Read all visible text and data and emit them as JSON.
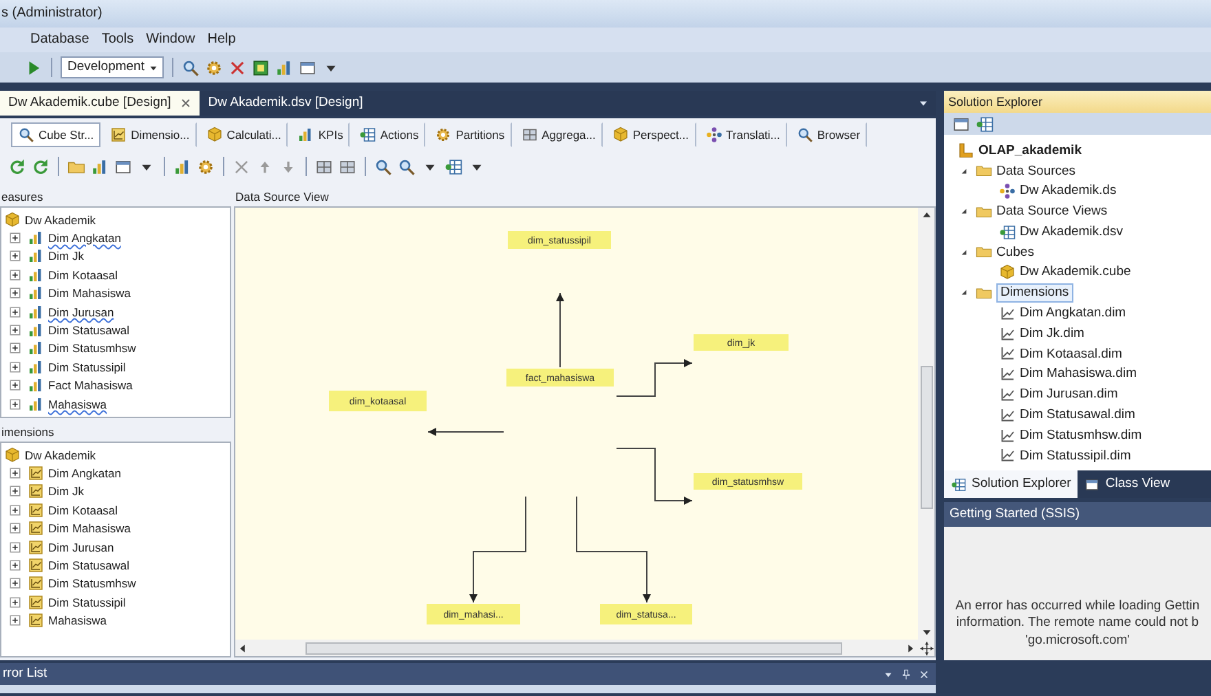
{
  "window": {
    "title": "s (Administrator)"
  },
  "menu": [
    {
      "label": "Database"
    },
    {
      "label": "Tools"
    },
    {
      "label": "Window"
    },
    {
      "label": "Help"
    }
  ],
  "toolbar": {
    "configuration": "Development"
  },
  "document_tabs": [
    {
      "label": "Dw Akademik.cube [Design]",
      "selected": true
    },
    {
      "label": "Dw Akademik.dsv [Design]",
      "selected": false
    }
  ],
  "designer_tabs": [
    {
      "label": "Cube Str...",
      "selected": true
    },
    {
      "label": "Dimensio...",
      "selected": false
    },
    {
      "label": "Calculati...",
      "selected": false
    },
    {
      "label": "KPIs",
      "selected": false
    },
    {
      "label": "Actions",
      "selected": false
    },
    {
      "label": "Partitions",
      "selected": false
    },
    {
      "label": "Aggrega...",
      "selected": false
    },
    {
      "label": "Perspect...",
      "selected": false
    },
    {
      "label": "Translati...",
      "selected": false
    },
    {
      "label": "Browser",
      "selected": false
    }
  ],
  "measures": {
    "title": "easures",
    "root": "Dw Akademik",
    "items": [
      {
        "label": "Dim Angkatan",
        "expanded": false,
        "flagged": true
      },
      {
        "label": "Dim Jk",
        "expanded": false,
        "flagged": false
      },
      {
        "label": "Dim Kotaasal",
        "expanded": false,
        "flagged": false
      },
      {
        "label": "Dim Mahasiswa",
        "expanded": false,
        "flagged": false
      },
      {
        "label": "Dim Jurusan",
        "expanded": false,
        "flagged": true
      },
      {
        "label": "Dim Statusawal",
        "expanded": false,
        "flagged": false
      },
      {
        "label": "Dim Statusmhsw",
        "expanded": false,
        "flagged": false
      },
      {
        "label": "Dim Statussipil",
        "expanded": false,
        "flagged": false
      },
      {
        "label": "Fact Mahasiswa",
        "expanded": false,
        "flagged": false
      },
      {
        "label": "Mahasiswa",
        "expanded": false,
        "flagged": true
      }
    ]
  },
  "dimensions": {
    "title": "imensions",
    "root": "Dw Akademik",
    "items": [
      {
        "label": "Dim Angkatan",
        "expanded": false
      },
      {
        "label": "Dim Jk",
        "expanded": false
      },
      {
        "label": "Dim Kotaasal",
        "expanded": false
      },
      {
        "label": "Dim Mahasiswa",
        "expanded": false
      },
      {
        "label": "Dim Jurusan",
        "expanded": false
      },
      {
        "label": "Dim Statusawal",
        "expanded": false
      },
      {
        "label": "Dim Statusmhsw",
        "expanded": false
      },
      {
        "label": "Dim Statussipil",
        "expanded": false
      },
      {
        "label": "Mahasiswa",
        "expanded": false
      }
    ]
  },
  "data_source_view": {
    "title": "Data Source View",
    "tables": [
      {
        "label": "dim_statussipil"
      },
      {
        "label": "fact_mahasiswa"
      },
      {
        "label": "dim_jk"
      },
      {
        "label": "dim_kotaasal"
      },
      {
        "label": "dim_statusmhsw"
      },
      {
        "label": "dim_mahasi..."
      },
      {
        "label": "dim_statusa..."
      }
    ]
  },
  "solution_explorer": {
    "title": "Solution Explorer",
    "tree": [
      {
        "label": "OLAP_akademik",
        "kind": "project",
        "selected": false,
        "children": [
          {
            "label": "Data Sources",
            "kind": "folder",
            "expanded": true,
            "selected": false,
            "children": [
              {
                "label": "Dw Akademik.ds",
                "kind": "data-source",
                "selected": false
              }
            ]
          },
          {
            "label": "Data Source Views",
            "kind": "folder",
            "expanded": true,
            "selected": false,
            "children": [
              {
                "label": "Dw Akademik.dsv",
                "kind": "dsv",
                "selected": false
              }
            ]
          },
          {
            "label": "Cubes",
            "kind": "folder",
            "expanded": true,
            "selected": false,
            "children": [
              {
                "label": "Dw Akademik.cube",
                "kind": "cube",
                "selected": false
              }
            ]
          },
          {
            "label": "Dimensions",
            "kind": "folder",
            "expanded": true,
            "selected": true,
            "children": [
              {
                "label": "Dim Angkatan.dim",
                "kind": "dimension",
                "selected": false
              },
              {
                "label": "Dim Jk.dim",
                "kind": "dimension",
                "selected": false
              },
              {
                "label": "Dim Kotaasal.dim",
                "kind": "dimension",
                "selected": false
              },
              {
                "label": "Dim Mahasiswa.dim",
                "kind": "dimension",
                "selected": false
              },
              {
                "label": "Dim Jurusan.dim",
                "kind": "dimension",
                "selected": false
              },
              {
                "label": "Dim Statusawal.dim",
                "kind": "dimension",
                "selected": false
              },
              {
                "label": "Dim Statusmhsw.dim",
                "kind": "dimension",
                "selected": false
              },
              {
                "label": "Dim Statussipil.dim",
                "kind": "dimension",
                "selected": false
              }
            ]
          }
        ]
      }
    ],
    "tabs": [
      {
        "label": "Solution Explorer",
        "selected": true
      },
      {
        "label": "Class View",
        "selected": false
      }
    ]
  },
  "getting_started": {
    "title": "Getting Started (SSIS)",
    "message": [
      "An error has occurred while loading Gettin",
      "information. The remote name could not b",
      "'go.microsoft.com'"
    ]
  },
  "error_list": {
    "title": "rror List"
  }
}
